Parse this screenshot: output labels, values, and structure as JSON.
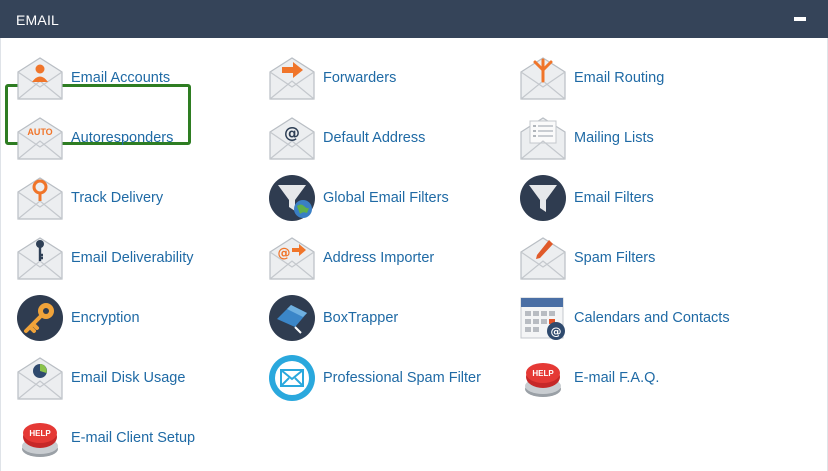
{
  "section": {
    "title": "EMAIL",
    "collapse_icon": "minus-icon"
  },
  "colors": {
    "header_bg": "#354459",
    "link": "#1f6aa5",
    "highlight": "#2e7d22"
  },
  "items": [
    {
      "label": "Email Accounts",
      "icon": "envelope-user-icon"
    },
    {
      "label": "Forwarders",
      "icon": "envelope-arrow-icon"
    },
    {
      "label": "Email Routing",
      "icon": "envelope-fork-icon"
    },
    {
      "label": "Autoresponders",
      "icon": "envelope-auto-icon",
      "icon_text": "AUTO"
    },
    {
      "label": "Default Address",
      "icon": "envelope-at-icon"
    },
    {
      "label": "Mailing Lists",
      "icon": "envelope-list-icon"
    },
    {
      "label": "Track Delivery",
      "icon": "envelope-location-pin-icon"
    },
    {
      "label": "Global Email Filters",
      "icon": "funnel-globe-icon"
    },
    {
      "label": "Email Filters",
      "icon": "funnel-icon"
    },
    {
      "label": "Email Deliverability",
      "icon": "envelope-key-icon"
    },
    {
      "label": "Address Importer",
      "icon": "envelope-import-icon"
    },
    {
      "label": "Spam Filters",
      "icon": "envelope-pen-icon"
    },
    {
      "label": "Encryption",
      "icon": "key-icon"
    },
    {
      "label": "BoxTrapper",
      "icon": "box-trap-icon"
    },
    {
      "label": "Calendars and Contacts",
      "icon": "calendar-at-icon"
    },
    {
      "label": "Email Disk Usage",
      "icon": "envelope-pie-chart-icon"
    },
    {
      "label": "Professional Spam Filter",
      "icon": "shield-envelope-icon"
    },
    {
      "label": "E-mail F.A.Q.",
      "icon": "help-button-icon",
      "icon_text": "HELP"
    },
    {
      "label": "E-mail Client Setup",
      "icon": "help-button-icon",
      "icon_text": "HELP"
    }
  ]
}
